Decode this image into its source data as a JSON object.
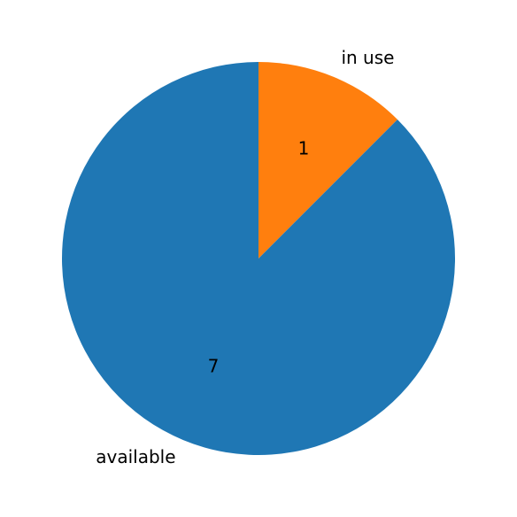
{
  "chart_data": {
    "type": "pie",
    "categories": [
      "in use",
      "available"
    ],
    "values": [
      1,
      7
    ],
    "value_labels": [
      "1",
      "7"
    ],
    "colors": [
      "#ff7f0e",
      "#1f77b4"
    ],
    "start_angle_deg": 90,
    "direction": "clockwise",
    "title": "",
    "legend": "none"
  }
}
